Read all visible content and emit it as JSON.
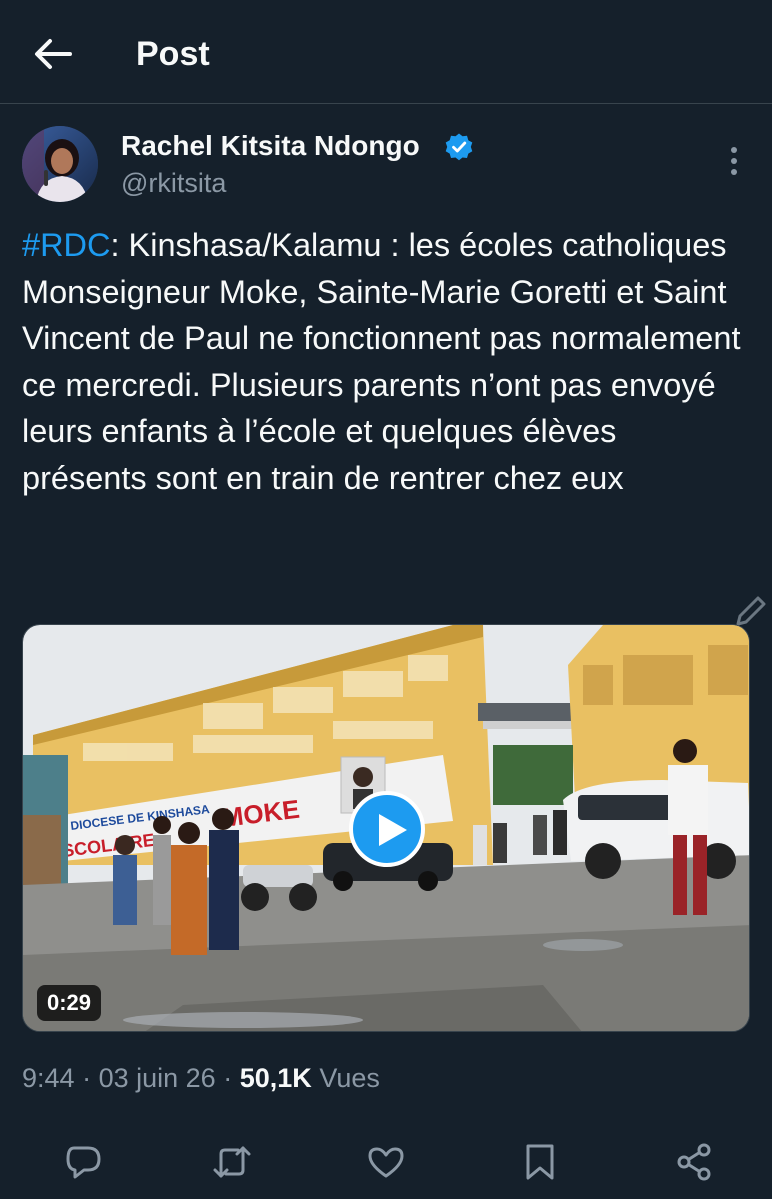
{
  "header": {
    "title": "Post",
    "back_icon": "arrow-left-icon"
  },
  "author": {
    "display_name": "Rachel Kitsita Ndongo",
    "handle": "@rkitsita",
    "verified": true,
    "verified_color": "#1d9bf0"
  },
  "tweet": {
    "hashtag": "#RDC",
    "text": ": Kinshasa/Kalamu : les écoles catholiques Monseigneur Moke, Sainte-Marie Goretti et Saint Vincent de Paul ne fonctionnent pas normalement ce mercredi. Plusieurs parents n’ont pas envoyé leurs enfants à l’école et quelques élèves présents sont en train de rentrer chez eux"
  },
  "media": {
    "type": "video",
    "duration": "0:29",
    "wall_text_1": "DIOCESE DE KINSHASA",
    "wall_text_2": "SCOLAIRE",
    "wall_text_3": "MOKE"
  },
  "meta": {
    "time": "9:44",
    "separator": "·",
    "date": "03 juin 26",
    "views_count": "50,1K",
    "views_label": "Vues"
  },
  "actions": [
    {
      "name": "reply",
      "icon": "reply-icon"
    },
    {
      "name": "repost",
      "icon": "repost-icon"
    },
    {
      "name": "like",
      "icon": "heart-icon"
    },
    {
      "name": "bookmark",
      "icon": "bookmark-icon"
    },
    {
      "name": "share",
      "icon": "share-icon"
    }
  ],
  "colors": {
    "background": "#15202b",
    "accent": "#1d9bf0",
    "secondary_text": "#8b98a5",
    "divider": "#38444d"
  }
}
